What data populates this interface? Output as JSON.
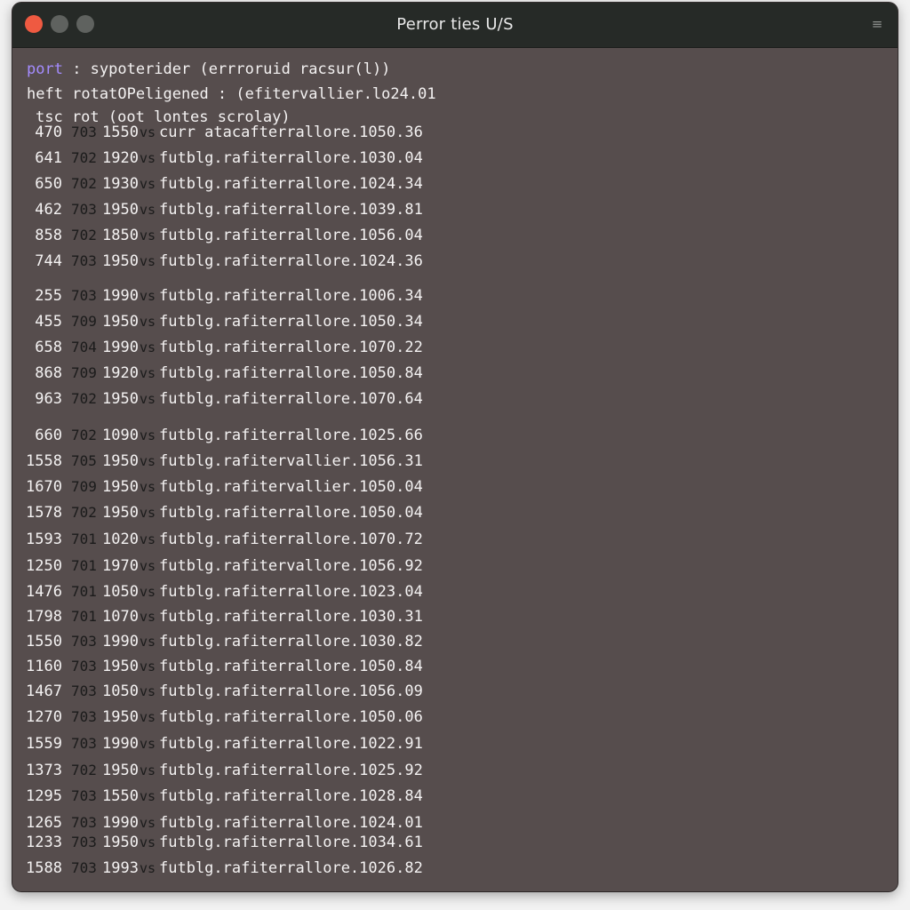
{
  "window": {
    "title": "Perror ties U/S",
    "menu_icon": "menu-icon"
  },
  "header": {
    "line1_keyword": "port",
    "line1_rest": " : sypoterider (errroruid racsur(l))",
    "line2": "heft rotatOPeligened : (efitervallier.lo24.01",
    "line3": "tsc rot (oot lontes scrolay)"
  },
  "rows": [
    {
      "c1": "470",
      "c2": "703",
      "c3": "1550",
      "c4": "vs",
      "c5": "curr atacafterrallore.1050.36"
    },
    {
      "c1": "641",
      "c2": "702",
      "c3": "1920",
      "c4": "vs",
      "c5": "futblg.rafiterrallore.1030.04"
    },
    {
      "c1": "650",
      "c2": "702",
      "c3": "1930",
      "c4": "vs",
      "c5": "futblg.rafiterrallore.1024.34"
    },
    {
      "c1": "462",
      "c2": "703",
      "c3": "1950",
      "c4": "vs",
      "c5": "futblg.rafiterrallore.1039.81"
    },
    {
      "c1": "858",
      "c2": "702",
      "c3": "1850",
      "c4": "vs",
      "c5": "futblg.rafiterrallore.1056.04"
    },
    {
      "c1": "744",
      "c2": "703",
      "c3": "1950",
      "c4": "vs",
      "c5": "futblg.rafiterrallore.1024.36"
    },
    {
      "c1": "255",
      "c2": "703",
      "c3": "1990",
      "c4": "vs",
      "c5": "futblg.rafiterrallore.1006.34"
    },
    {
      "c1": "455",
      "c2": "709",
      "c3": "1950",
      "c4": "vs",
      "c5": "futblg.rafiterrallore.1050.34"
    },
    {
      "c1": "658",
      "c2": "704",
      "c3": "1990",
      "c4": "vs",
      "c5": "futblg.rafiterrallore.1070.22"
    },
    {
      "c1": "868",
      "c2": "709",
      "c3": "1920",
      "c4": "vs",
      "c5": "futblg.rafiterrallore.1050.84"
    },
    {
      "c1": "963",
      "c2": "702",
      "c3": "1950",
      "c4": "vs",
      "c5": "futblg.rafiterrallore.1070.64"
    },
    {
      "c1": "660",
      "c2": "702",
      "c3": "1090",
      "c4": "vs",
      "c5": "futblg.rafiterrallore.1025.66"
    },
    {
      "c1": "1558",
      "c2": "705",
      "c3": "1950",
      "c4": "vs",
      "c5": "futblg.rafitervallier.1056.31"
    },
    {
      "c1": "1670",
      "c2": "709",
      "c3": "1950",
      "c4": "vs",
      "c5": "futblg.rafitervallier.1050.04"
    },
    {
      "c1": "1578",
      "c2": "702",
      "c3": "1950",
      "c4": "vs",
      "c5": "futblg.rafiterrallore.1050.04"
    },
    {
      "c1": "1593",
      "c2": "701",
      "c3": "1020",
      "c4": "vs",
      "c5": "futblg.rafiterrallore.1070.72"
    },
    {
      "c1": "1250",
      "c2": "701",
      "c3": "1970",
      "c4": "vs",
      "c5": "futblg.rafitervallore.1056.92"
    },
    {
      "c1": "1476",
      "c2": "701",
      "c3": "1050",
      "c4": "vs",
      "c5": "futblg.rafiterrallore.1023.04"
    },
    {
      "c1": "1798",
      "c2": "701",
      "c3": "1070",
      "c4": "vs",
      "c5": "futblg.rafiterrallore.1030.31"
    },
    {
      "c1": "1550",
      "c2": "703",
      "c3": "1990",
      "c4": "vs",
      "c5": "futblg.rafiterrallore.1030.82"
    },
    {
      "c1": "1160",
      "c2": "703",
      "c3": "1950",
      "c4": "vs",
      "c5": "futblg.rafiterrallore.1050.84"
    },
    {
      "c1": "1467",
      "c2": "703",
      "c3": "1050",
      "c4": "vs",
      "c5": "futblg.rafiterrallore.1056.09"
    },
    {
      "c1": "1270",
      "c2": "703",
      "c3": "1950",
      "c4": "vs",
      "c5": "futblg.rafiterrallore.1050.06"
    },
    {
      "c1": "1559",
      "c2": "703",
      "c3": "1990",
      "c4": "vs",
      "c5": "futblg.rafiterrallore.1022.91"
    },
    {
      "c1": "1373",
      "c2": "702",
      "c3": "1950",
      "c4": "vs",
      "c5": "futblg.rafiterrallore.1025.92"
    },
    {
      "c1": "1295",
      "c2": "703",
      "c3": "1550",
      "c4": "vs",
      "c5": "futblg.rafiterrallore.1028.84"
    },
    {
      "c1": "1265",
      "c2": "703",
      "c3": "1990",
      "c4": "vs",
      "c5": "futblg.rafiterrallore.1024.01"
    },
    {
      "c1": "1233",
      "c2": "703",
      "c3": "1950",
      "c4": "vs",
      "c5": "futblg.rafiterrallore.1034.61"
    },
    {
      "c1": "1588",
      "c2": "703",
      "c3": "1993",
      "c4": "vs",
      "c5": "futblg.rafiterrallore.1026.82"
    }
  ]
}
